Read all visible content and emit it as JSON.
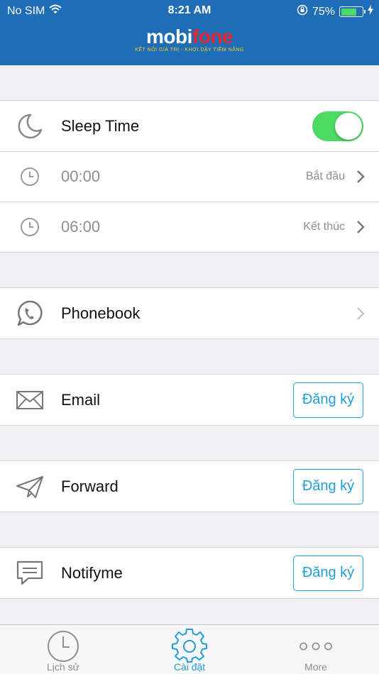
{
  "status_bar": {
    "carrier": "No SIM",
    "time": "8:21 AM",
    "battery_percent": "75%",
    "battery_level": 0.75,
    "icons": [
      "wifi-icon",
      "orientation-lock-icon",
      "battery-icon",
      "charging-icon"
    ]
  },
  "header": {
    "logo_mobi": "mobi",
    "logo_fone": "fone",
    "tagline": "KẾT NỐI GIÁ TRỊ  -  KHƠI DẬY TIỀM NĂNG"
  },
  "sleep": {
    "label": "Sleep Time",
    "enabled": true,
    "start_time": "00:00",
    "start_label": "Bắt đầu",
    "end_time": "06:00",
    "end_label": "Kết thúc"
  },
  "phonebook": {
    "label": "Phonebook"
  },
  "services": [
    {
      "label": "Email",
      "button": "Đăng ký",
      "icon": "mail-icon"
    },
    {
      "label": "Forward",
      "button": "Đăng ký",
      "icon": "paper-plane-icon"
    },
    {
      "label": "Notifyme",
      "button": "Đăng ký",
      "icon": "message-icon"
    }
  ],
  "tabs": [
    {
      "label": "Lịch sử",
      "icon": "clock-icon",
      "active": false
    },
    {
      "label": "Cài đặt",
      "icon": "gear-icon",
      "active": true
    },
    {
      "label": "More",
      "icon": "more-dots-icon",
      "active": false
    }
  ],
  "colors": {
    "header_bg": "#1f6db7",
    "accent": "#1e9fd8",
    "toggle_on": "#4cd964",
    "logo_red": "#e8262b",
    "tagline_yellow": "#f5d21c"
  }
}
